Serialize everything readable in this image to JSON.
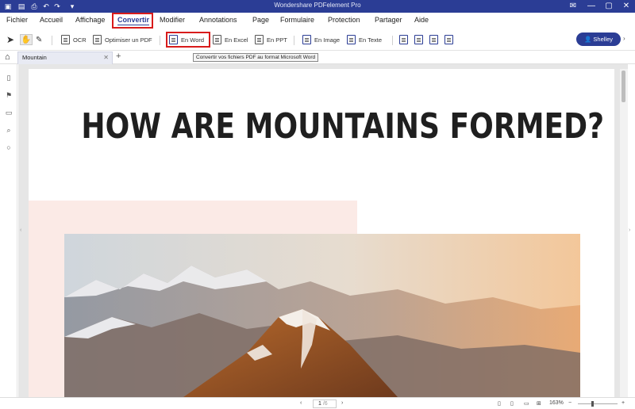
{
  "app": {
    "title": "Wondershare PDFelement Pro"
  },
  "menu": {
    "items": [
      "Fichier",
      "Accueil",
      "Affichage",
      "Convertir",
      "Modifier",
      "Annotations",
      "Page",
      "Formulaire",
      "Protection",
      "Partager",
      "Aide"
    ],
    "active": "Convertir"
  },
  "toolbar": {
    "ocr": "OCR",
    "optimize": "Optimiser un PDF",
    "word": "En Word",
    "excel": "En Excel",
    "ppt": "En PPT",
    "image": "En Image",
    "text": "En Texte"
  },
  "user": {
    "name": "Shelley"
  },
  "tooltip": {
    "text": "Convertir vos fichiers PDF au format Microsoft Word"
  },
  "tabs": [
    {
      "label": "Mountain"
    }
  ],
  "document": {
    "headline": "HOW ARE MOUNTAINS FORMED?"
  },
  "status": {
    "page_current": "1",
    "page_total": "/6",
    "zoom": "163%"
  },
  "colors": {
    "titlebar": "#2b3d95",
    "highlight": "#d81b1b",
    "accent": "#2b3d95"
  }
}
